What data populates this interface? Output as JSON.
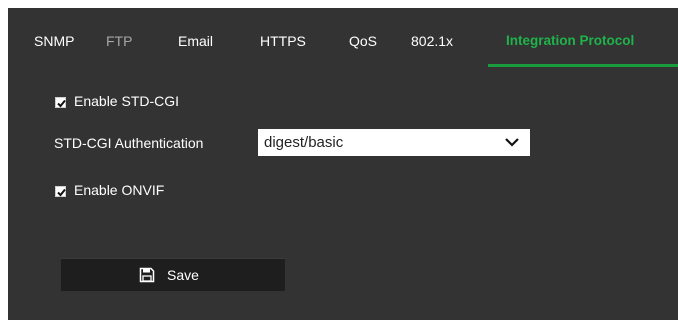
{
  "tabs": [
    {
      "label": "SNMP",
      "state": "normal"
    },
    {
      "label": "FTP",
      "state": "inactive"
    },
    {
      "label": "Email",
      "state": "normal"
    },
    {
      "label": "HTTPS",
      "state": "normal"
    },
    {
      "label": "QoS",
      "state": "normal"
    },
    {
      "label": "802.1x",
      "state": "normal"
    },
    {
      "label": "Integration Protocol",
      "state": "active"
    }
  ],
  "settings": {
    "enable_std_cgi": {
      "label": "Enable STD-CGI",
      "checked": true
    },
    "std_cgi_auth": {
      "label": "STD-CGI Authentication",
      "value": "digest/basic"
    },
    "enable_onvif": {
      "label": "Enable ONVIF",
      "checked": true
    }
  },
  "save_button": {
    "label": "Save",
    "icon": "floppy-disk-icon"
  },
  "colors": {
    "background": "#333333",
    "active_tab": "#1fb34a",
    "inactive_tab": "#a6a6a6",
    "button": "#1e1e1e"
  }
}
